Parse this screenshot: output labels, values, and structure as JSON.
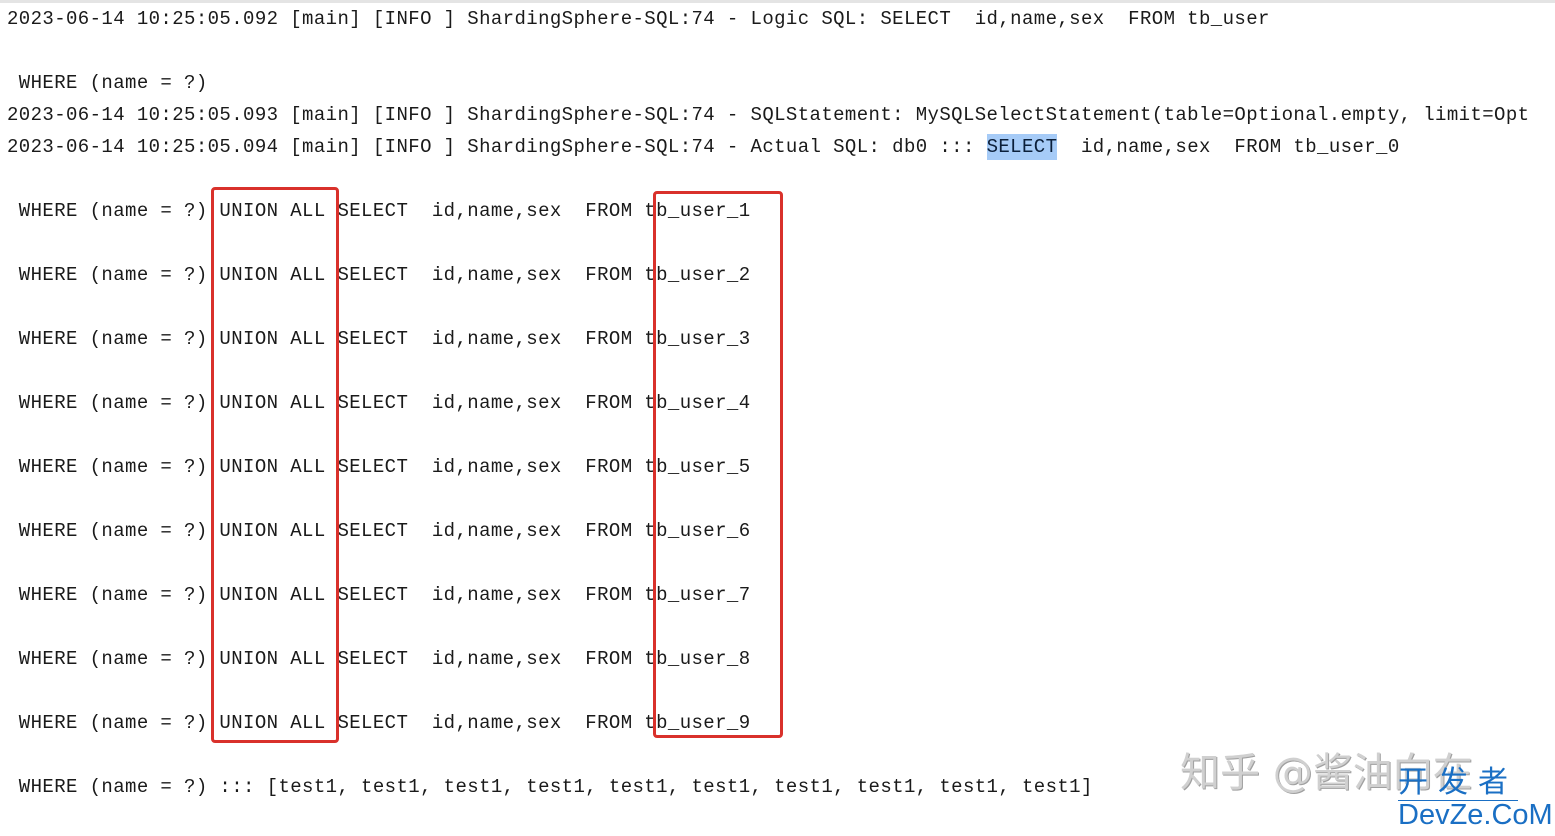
{
  "log": {
    "line_logic": "2023-06-14 10:25:05.092 [main] [INFO ] ShardingSphere-SQL:74 - Logic SQL: SELECT  id,name,sex  FROM tb_user",
    "line_where0": " WHERE (name = ?)",
    "line_statement": "2023-06-14 10:25:05.093 [main] [INFO ] ShardingSphere-SQL:74 - SQLStatement: MySQLSelectStatement(table=Optional.empty, limit=Opt",
    "actual_prefix": "2023-06-14 10:25:05.094 [main] [INFO ] ShardingSphere-SQL:74 - Actual SQL: db0 ::: ",
    "actual_highlight": "SELECT",
    "actual_suffix": "  id,name,sex  FROM tb_user_0",
    "union_lines": [
      " WHERE (name = ?) UNION ALL SELECT  id,name,sex  FROM tb_user_1",
      " WHERE (name = ?) UNION ALL SELECT  id,name,sex  FROM tb_user_2",
      " WHERE (name = ?) UNION ALL SELECT  id,name,sex  FROM tb_user_3",
      " WHERE (name = ?) UNION ALL SELECT  id,name,sex  FROM tb_user_4",
      " WHERE (name = ?) UNION ALL SELECT  id,name,sex  FROM tb_user_5",
      " WHERE (name = ?) UNION ALL SELECT  id,name,sex  FROM tb_user_6",
      " WHERE (name = ?) UNION ALL SELECT  id,name,sex  FROM tb_user_7",
      " WHERE (name = ?) UNION ALL SELECT  id,name,sex  FROM tb_user_8",
      " WHERE (name = ?) UNION ALL SELECT  id,name,sex  FROM tb_user_9"
    ],
    "line_params": " WHERE (name = ?) ::: [test1, test1, test1, test1, test1, test1, test1, test1, test1, test1]"
  },
  "annotations": {
    "box_color": "#d9312b",
    "highlight_color": "#a6cbf7"
  },
  "watermarks": {
    "zhihu": "知乎 @酱油向在",
    "devze_cn": "开发者",
    "devze_en": "DevZe.CoM"
  }
}
